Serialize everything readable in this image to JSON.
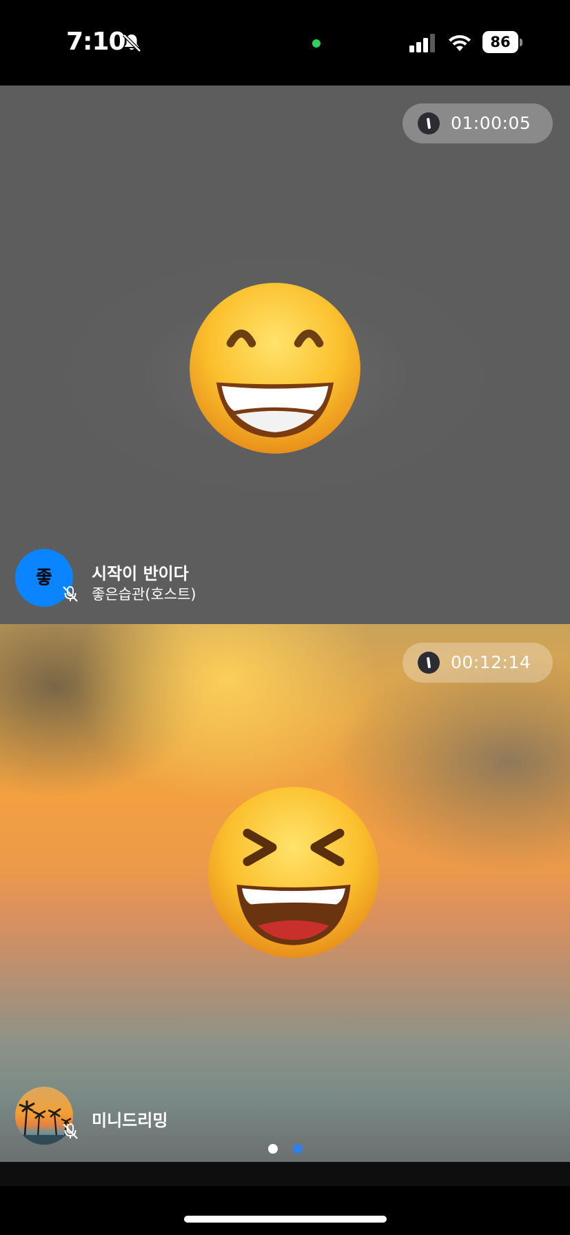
{
  "status_bar": {
    "time": "7:10",
    "battery": "86",
    "icons": [
      "bell-off-icon",
      "recording-indicator",
      "cellular-signal-icon",
      "wifi-icon",
      "battery-icon"
    ]
  },
  "host_tile": {
    "timer": "01:00:05",
    "emoji": "grinning-smiling-eyes",
    "avatar_text": "좋",
    "room_title": "시작이 반이다",
    "host_name": "좋은습관(호스트)",
    "mic_state": "muted",
    "accent_color": "#0a84ff"
  },
  "guest_tile": {
    "timer": "00:12:14",
    "emoji": "grinning-squinting",
    "avatar_image": "sunset-palm-trees",
    "name": "미니드리밍",
    "mic_state": "muted"
  },
  "pager": {
    "count": 2,
    "active_index": 1,
    "active_color": "#2f80ed",
    "inactive_color": "#ffffff"
  }
}
